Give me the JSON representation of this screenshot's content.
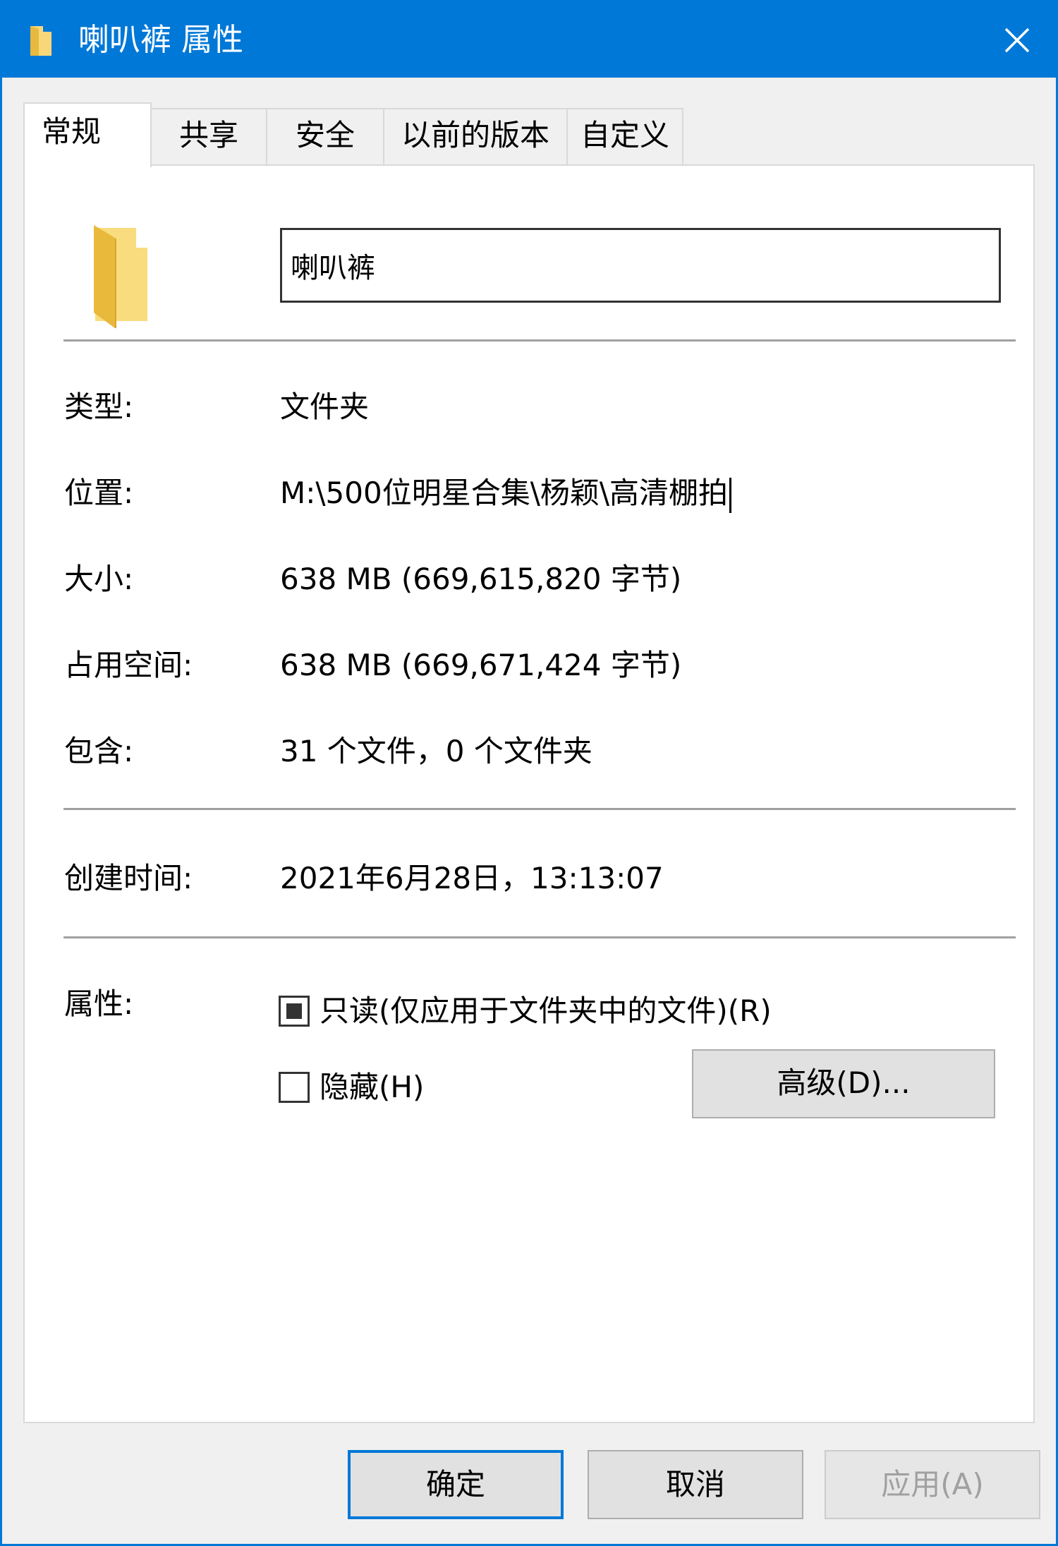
{
  "window": {
    "title": "喇叭裤 属性",
    "title_icon": "folder-icon",
    "close_icon": "close-icon"
  },
  "tabs": [
    {
      "label": "常规",
      "active": true
    },
    {
      "label": "共享",
      "active": false
    },
    {
      "label": "安全",
      "active": false
    },
    {
      "label": "以前的版本",
      "active": false
    },
    {
      "label": "自定义",
      "active": false
    }
  ],
  "general": {
    "folder_icon": "folder-icon",
    "name_value": "喇叭裤",
    "rows": [
      {
        "label": "类型:",
        "value": "文件夹"
      },
      {
        "label": "位置:",
        "value": "M:\\500位明星合集\\杨颖\\高清棚拍"
      },
      {
        "label": "大小:",
        "value": "638 MB (669,615,820 字节)"
      },
      {
        "label": "占用空间:",
        "value": "638 MB (669,671,424 字节)"
      },
      {
        "label": "包含:",
        "value": "31 个文件，0 个文件夹"
      }
    ],
    "created": {
      "label": "创建时间:",
      "value": "2021年6月28日，13:13:07"
    },
    "attributes": {
      "label": "属性:",
      "readonly_label": "只读(仅应用于文件夹中的文件)(R)",
      "readonly_state": "indeterminate",
      "hidden_label": "隐藏(H)",
      "hidden_checked": false,
      "advanced_button": "高级(D)..."
    }
  },
  "footer": {
    "ok": "确定",
    "cancel": "取消",
    "apply": "应用(A)",
    "apply_disabled": true
  },
  "colors": {
    "accent": "#0078d7",
    "folder": "#f2c94c"
  }
}
